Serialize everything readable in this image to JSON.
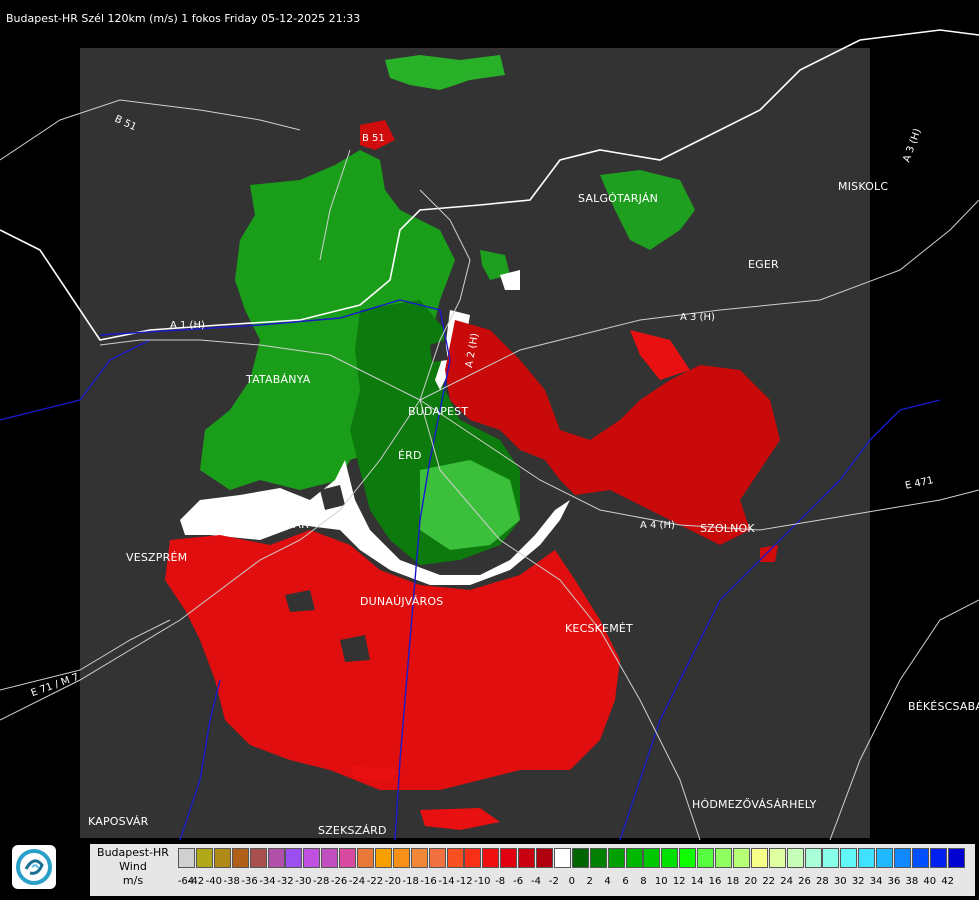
{
  "header": {
    "title": "Budapest-HR Szél 120km (m/s) 1 fokos Friday 05-12-2025 21:33"
  },
  "map": {
    "cities": [
      "SALGÓTARJÁN",
      "MISKOLC",
      "EGER",
      "TATABÁNYA",
      "BUDAPEST",
      "ÉRD",
      "SZÉKESFEHÉRVÁR",
      "VESZPRÉM",
      "DUNAÚJVÁROS",
      "KECSKEMÉT",
      "SZOLNOK",
      "BÉKÉSCSABA",
      "KAPOSVÁR",
      "SZEKSZÁRD",
      "HÓDMEZŐVÁSÁRHELY"
    ],
    "roads": [
      "B 51",
      "B 51",
      "A 3 (H)",
      "A 3 (H)",
      "A 1 (H)",
      "A 2 (H)",
      "A 4 (H)",
      "E 471",
      "E 71 / M 7"
    ],
    "colors": {
      "background": "#000000",
      "radar_area": "#333333",
      "border": "#ffffff",
      "rivers": "#0000cc"
    }
  },
  "legend": {
    "title_lines": [
      "Budapest-HR",
      "Wind",
      "m/s"
    ],
    "colors": [
      "#d0d0d0",
      "#b0a818",
      "#b08a18",
      "#b06018",
      "#a85050",
      "#b050a8",
      "#9a50f0",
      "#c050e0",
      "#c050c0",
      "#d84aa0",
      "#e87838",
      "#f8a000",
      "#f89018",
      "#f08838",
      "#f07040",
      "#f85020",
      "#f83018",
      "#f01010",
      "#e00010",
      "#c80010",
      "#b00010",
      "#ffffff",
      "#006400",
      "#008000",
      "#00a000",
      "#00b800",
      "#00c800",
      "#00e000",
      "#10ff00",
      "#58ff40",
      "#90ff60",
      "#b8ff78",
      "#f8ff88",
      "#e0ffa0",
      "#c8ffb8",
      "#a8ffd8",
      "#88ffe8",
      "#60f8f8",
      "#40e0ff",
      "#20b8ff",
      "#1088ff",
      "#0050ff",
      "#0020f0",
      "#0000d0"
    ],
    "ticks": [
      "-64",
      "-42",
      "-40",
      "-38",
      "-36",
      "-34",
      "-32",
      "-30",
      "-28",
      "-26",
      "-24",
      "-22",
      "-20",
      "-18",
      "-16",
      "-14",
      "-12",
      "-10",
      "-8",
      "-6",
      "-4",
      "-2",
      "0",
      "2",
      "4",
      "6",
      "8",
      "10",
      "12",
      "14",
      "16",
      "18",
      "20",
      "22",
      "24",
      "26",
      "28",
      "30",
      "32",
      "34",
      "36",
      "38",
      "40",
      "42"
    ]
  }
}
